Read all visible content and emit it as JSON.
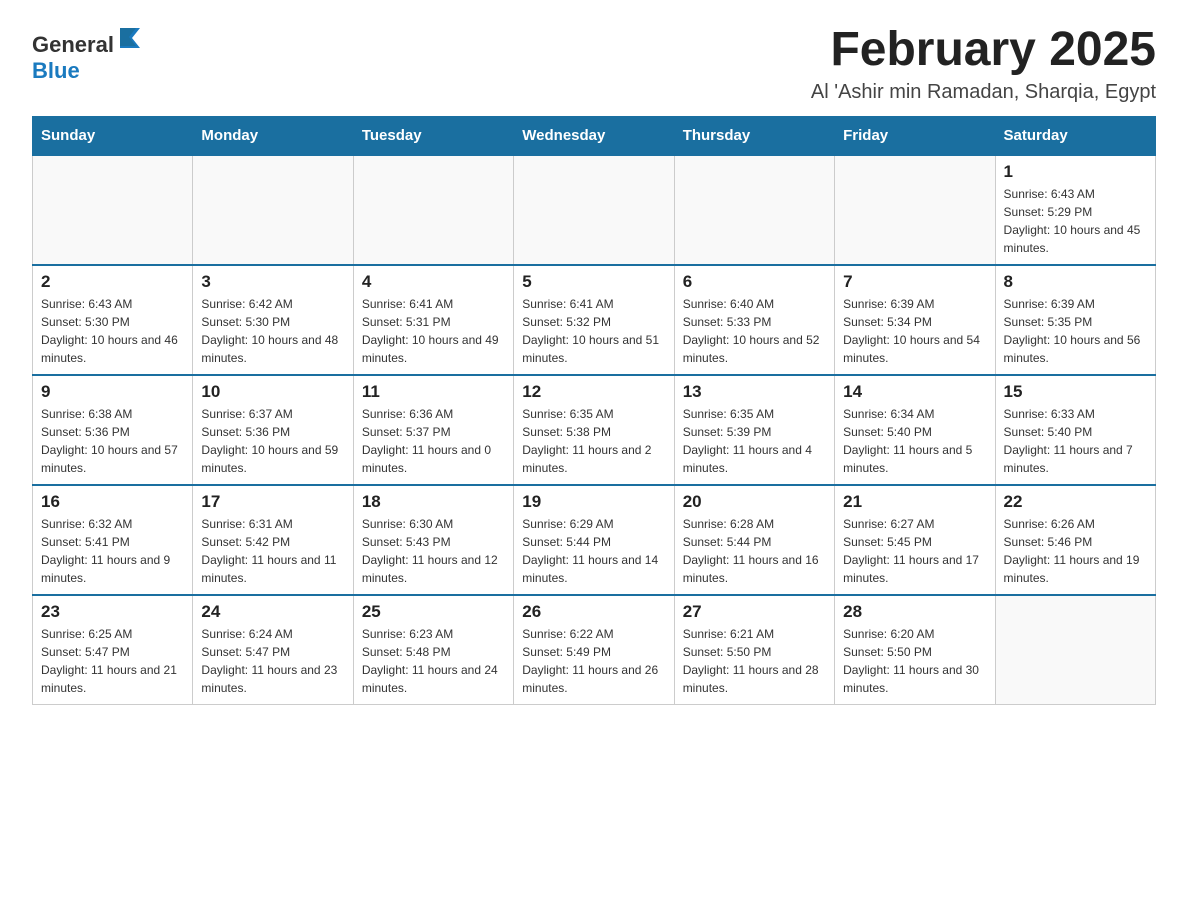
{
  "header": {
    "logo_general": "General",
    "logo_blue": "Blue",
    "month_title": "February 2025",
    "subtitle": "Al 'Ashir min Ramadan, Sharqia, Egypt"
  },
  "days_of_week": [
    "Sunday",
    "Monday",
    "Tuesday",
    "Wednesday",
    "Thursday",
    "Friday",
    "Saturday"
  ],
  "weeks": [
    [
      {
        "day": "",
        "sunrise": "",
        "sunset": "",
        "daylight": ""
      },
      {
        "day": "",
        "sunrise": "",
        "sunset": "",
        "daylight": ""
      },
      {
        "day": "",
        "sunrise": "",
        "sunset": "",
        "daylight": ""
      },
      {
        "day": "",
        "sunrise": "",
        "sunset": "",
        "daylight": ""
      },
      {
        "day": "",
        "sunrise": "",
        "sunset": "",
        "daylight": ""
      },
      {
        "day": "",
        "sunrise": "",
        "sunset": "",
        "daylight": ""
      },
      {
        "day": "1",
        "sunrise": "Sunrise: 6:43 AM",
        "sunset": "Sunset: 5:29 PM",
        "daylight": "Daylight: 10 hours and 45 minutes."
      }
    ],
    [
      {
        "day": "2",
        "sunrise": "Sunrise: 6:43 AM",
        "sunset": "Sunset: 5:30 PM",
        "daylight": "Daylight: 10 hours and 46 minutes."
      },
      {
        "day": "3",
        "sunrise": "Sunrise: 6:42 AM",
        "sunset": "Sunset: 5:30 PM",
        "daylight": "Daylight: 10 hours and 48 minutes."
      },
      {
        "day": "4",
        "sunrise": "Sunrise: 6:41 AM",
        "sunset": "Sunset: 5:31 PM",
        "daylight": "Daylight: 10 hours and 49 minutes."
      },
      {
        "day": "5",
        "sunrise": "Sunrise: 6:41 AM",
        "sunset": "Sunset: 5:32 PM",
        "daylight": "Daylight: 10 hours and 51 minutes."
      },
      {
        "day": "6",
        "sunrise": "Sunrise: 6:40 AM",
        "sunset": "Sunset: 5:33 PM",
        "daylight": "Daylight: 10 hours and 52 minutes."
      },
      {
        "day": "7",
        "sunrise": "Sunrise: 6:39 AM",
        "sunset": "Sunset: 5:34 PM",
        "daylight": "Daylight: 10 hours and 54 minutes."
      },
      {
        "day": "8",
        "sunrise": "Sunrise: 6:39 AM",
        "sunset": "Sunset: 5:35 PM",
        "daylight": "Daylight: 10 hours and 56 minutes."
      }
    ],
    [
      {
        "day": "9",
        "sunrise": "Sunrise: 6:38 AM",
        "sunset": "Sunset: 5:36 PM",
        "daylight": "Daylight: 10 hours and 57 minutes."
      },
      {
        "day": "10",
        "sunrise": "Sunrise: 6:37 AM",
        "sunset": "Sunset: 5:36 PM",
        "daylight": "Daylight: 10 hours and 59 minutes."
      },
      {
        "day": "11",
        "sunrise": "Sunrise: 6:36 AM",
        "sunset": "Sunset: 5:37 PM",
        "daylight": "Daylight: 11 hours and 0 minutes."
      },
      {
        "day": "12",
        "sunrise": "Sunrise: 6:35 AM",
        "sunset": "Sunset: 5:38 PM",
        "daylight": "Daylight: 11 hours and 2 minutes."
      },
      {
        "day": "13",
        "sunrise": "Sunrise: 6:35 AM",
        "sunset": "Sunset: 5:39 PM",
        "daylight": "Daylight: 11 hours and 4 minutes."
      },
      {
        "day": "14",
        "sunrise": "Sunrise: 6:34 AM",
        "sunset": "Sunset: 5:40 PM",
        "daylight": "Daylight: 11 hours and 5 minutes."
      },
      {
        "day": "15",
        "sunrise": "Sunrise: 6:33 AM",
        "sunset": "Sunset: 5:40 PM",
        "daylight": "Daylight: 11 hours and 7 minutes."
      }
    ],
    [
      {
        "day": "16",
        "sunrise": "Sunrise: 6:32 AM",
        "sunset": "Sunset: 5:41 PM",
        "daylight": "Daylight: 11 hours and 9 minutes."
      },
      {
        "day": "17",
        "sunrise": "Sunrise: 6:31 AM",
        "sunset": "Sunset: 5:42 PM",
        "daylight": "Daylight: 11 hours and 11 minutes."
      },
      {
        "day": "18",
        "sunrise": "Sunrise: 6:30 AM",
        "sunset": "Sunset: 5:43 PM",
        "daylight": "Daylight: 11 hours and 12 minutes."
      },
      {
        "day": "19",
        "sunrise": "Sunrise: 6:29 AM",
        "sunset": "Sunset: 5:44 PM",
        "daylight": "Daylight: 11 hours and 14 minutes."
      },
      {
        "day": "20",
        "sunrise": "Sunrise: 6:28 AM",
        "sunset": "Sunset: 5:44 PM",
        "daylight": "Daylight: 11 hours and 16 minutes."
      },
      {
        "day": "21",
        "sunrise": "Sunrise: 6:27 AM",
        "sunset": "Sunset: 5:45 PM",
        "daylight": "Daylight: 11 hours and 17 minutes."
      },
      {
        "day": "22",
        "sunrise": "Sunrise: 6:26 AM",
        "sunset": "Sunset: 5:46 PM",
        "daylight": "Daylight: 11 hours and 19 minutes."
      }
    ],
    [
      {
        "day": "23",
        "sunrise": "Sunrise: 6:25 AM",
        "sunset": "Sunset: 5:47 PM",
        "daylight": "Daylight: 11 hours and 21 minutes."
      },
      {
        "day": "24",
        "sunrise": "Sunrise: 6:24 AM",
        "sunset": "Sunset: 5:47 PM",
        "daylight": "Daylight: 11 hours and 23 minutes."
      },
      {
        "day": "25",
        "sunrise": "Sunrise: 6:23 AM",
        "sunset": "Sunset: 5:48 PM",
        "daylight": "Daylight: 11 hours and 24 minutes."
      },
      {
        "day": "26",
        "sunrise": "Sunrise: 6:22 AM",
        "sunset": "Sunset: 5:49 PM",
        "daylight": "Daylight: 11 hours and 26 minutes."
      },
      {
        "day": "27",
        "sunrise": "Sunrise: 6:21 AM",
        "sunset": "Sunset: 5:50 PM",
        "daylight": "Daylight: 11 hours and 28 minutes."
      },
      {
        "day": "28",
        "sunrise": "Sunrise: 6:20 AM",
        "sunset": "Sunset: 5:50 PM",
        "daylight": "Daylight: 11 hours and 30 minutes."
      },
      {
        "day": "",
        "sunrise": "",
        "sunset": "",
        "daylight": ""
      }
    ]
  ]
}
